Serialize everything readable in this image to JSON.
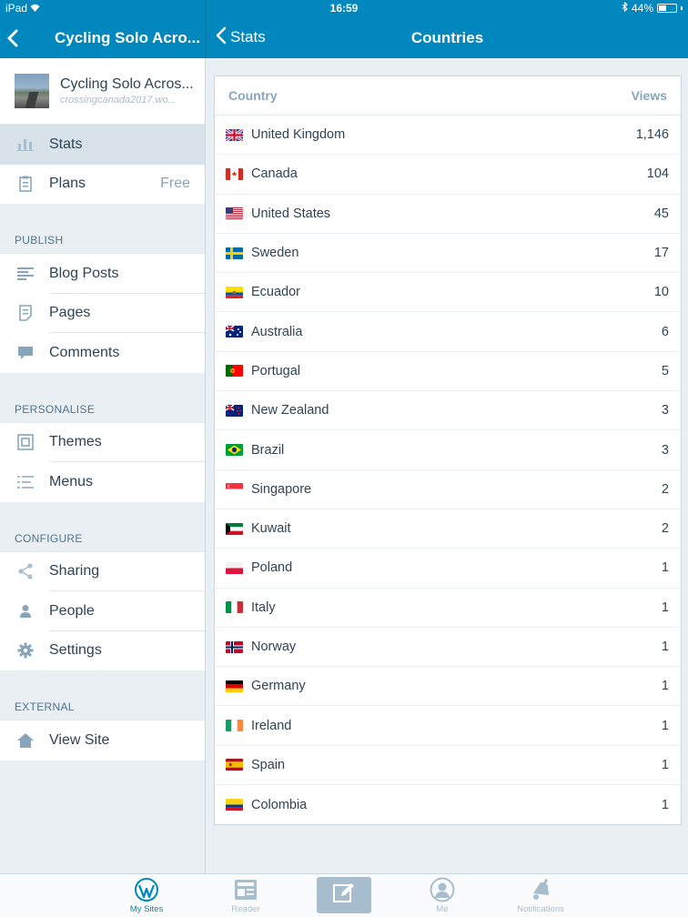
{
  "status_bar": {
    "device": "iPad",
    "time": "16:59",
    "battery": "44%"
  },
  "left_nav": {
    "title": "Cycling Solo Acro..."
  },
  "right_nav": {
    "back_label": "Stats",
    "title": "Countries"
  },
  "site": {
    "name": "Cycling Solo Acros...",
    "url": "crossingcanada2017.wo..."
  },
  "sidebar": {
    "top_items": [
      {
        "label": "Stats",
        "icon": "bar-chart-icon"
      },
      {
        "label": "Plans",
        "icon": "clipboard-icon",
        "extra": "Free"
      }
    ],
    "sections": [
      {
        "label": "PUBLISH",
        "items": [
          {
            "label": "Blog Posts",
            "icon": "posts-icon"
          },
          {
            "label": "Pages",
            "icon": "page-icon"
          },
          {
            "label": "Comments",
            "icon": "comment-icon"
          }
        ]
      },
      {
        "label": "PERSONALISE",
        "items": [
          {
            "label": "Themes",
            "icon": "themes-icon"
          },
          {
            "label": "Menus",
            "icon": "menus-icon"
          }
        ]
      },
      {
        "label": "CONFIGURE",
        "items": [
          {
            "label": "Sharing",
            "icon": "share-icon"
          },
          {
            "label": "People",
            "icon": "person-icon"
          },
          {
            "label": "Settings",
            "icon": "gear-icon"
          }
        ]
      },
      {
        "label": "EXTERNAL",
        "items": [
          {
            "label": "View Site",
            "icon": "house-icon"
          }
        ]
      }
    ]
  },
  "table": {
    "col_country": "Country",
    "col_views": "Views",
    "rows": [
      {
        "country": "United Kingdom",
        "views": "1,146",
        "flag": "gb"
      },
      {
        "country": "Canada",
        "views": "104",
        "flag": "ca"
      },
      {
        "country": "United States",
        "views": "45",
        "flag": "us"
      },
      {
        "country": "Sweden",
        "views": "17",
        "flag": "se"
      },
      {
        "country": "Ecuador",
        "views": "10",
        "flag": "ec"
      },
      {
        "country": "Australia",
        "views": "6",
        "flag": "au"
      },
      {
        "country": "Portugal",
        "views": "5",
        "flag": "pt"
      },
      {
        "country": "New Zealand",
        "views": "3",
        "flag": "nz"
      },
      {
        "country": "Brazil",
        "views": "3",
        "flag": "br"
      },
      {
        "country": "Singapore",
        "views": "2",
        "flag": "sg"
      },
      {
        "country": "Kuwait",
        "views": "2",
        "flag": "kw"
      },
      {
        "country": "Poland",
        "views": "1",
        "flag": "pl"
      },
      {
        "country": "Italy",
        "views": "1",
        "flag": "it"
      },
      {
        "country": "Norway",
        "views": "1",
        "flag": "no"
      },
      {
        "country": "Germany",
        "views": "1",
        "flag": "de"
      },
      {
        "country": "Ireland",
        "views": "1",
        "flag": "ie"
      },
      {
        "country": "Spain",
        "views": "1",
        "flag": "es"
      },
      {
        "country": "Colombia",
        "views": "1",
        "flag": "co"
      }
    ]
  },
  "tabbar": {
    "tabs": [
      {
        "label": "My Sites",
        "icon": "wordpress-icon",
        "active": true
      },
      {
        "label": "Reader",
        "icon": "reader-icon"
      },
      {
        "label": "",
        "icon": "write-icon"
      },
      {
        "label": "Me",
        "icon": "me-icon"
      },
      {
        "label": "Notifications",
        "icon": "bell-icon"
      }
    ]
  },
  "colors": {
    "accent": "#0087be",
    "sidebar_bg": "#e9eff3",
    "text": "#2e4453",
    "muted": "#87a6bc"
  }
}
